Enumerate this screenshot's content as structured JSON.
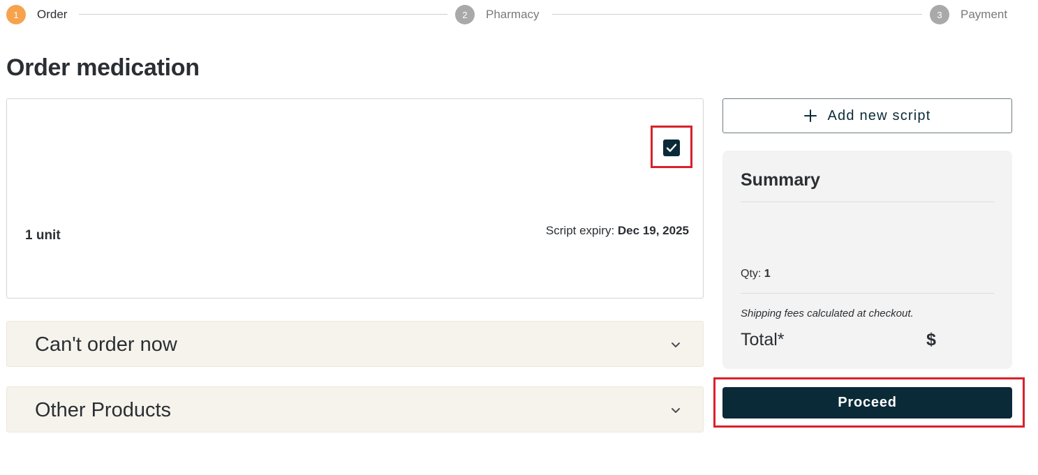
{
  "stepper": {
    "steps": [
      {
        "number": "1",
        "label": "Order",
        "state": "active"
      },
      {
        "number": "2",
        "label": "Pharmacy",
        "state": "inactive"
      },
      {
        "number": "3",
        "label": "Payment",
        "state": "inactive"
      }
    ]
  },
  "page": {
    "title": "Order medication"
  },
  "medication_card": {
    "checkbox_checked": true,
    "unit": "1 unit",
    "expiry_label": "Script expiry:",
    "expiry_value": "Dec 19, 2025"
  },
  "accordions": [
    {
      "label": "Can't order now"
    },
    {
      "label": "Other Products"
    }
  ],
  "add_script": {
    "label": "Add new script"
  },
  "summary": {
    "title": "Summary",
    "qty_label": "Qty:",
    "qty_value": "1",
    "shipping_note": "Shipping fees calculated at checkout.",
    "total_label": "Total*",
    "total_value": "$"
  },
  "proceed": {
    "label": "Proceed"
  },
  "colors": {
    "accent_orange": "#f7a24d",
    "primary_dark": "#0b2a38",
    "highlight_red": "#d9212c",
    "accordion_bg": "#f6f3ec",
    "summary_bg": "#f3f3f3"
  }
}
